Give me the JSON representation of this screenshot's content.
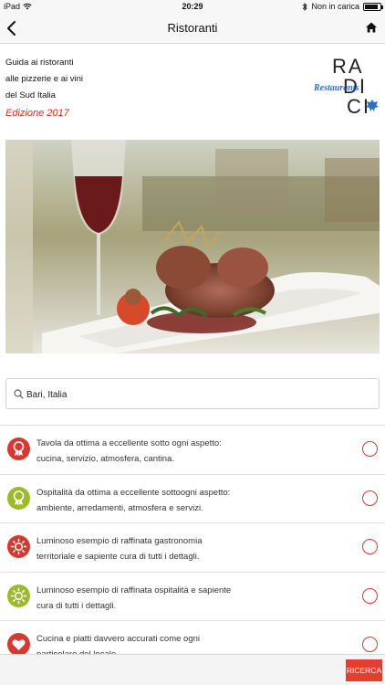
{
  "status_bar": {
    "device": "iPad",
    "time": "20:29",
    "charging": "Non in carica",
    "battery_level": 0.85
  },
  "nav": {
    "title": "Ristoranti",
    "back_icon": "chevron-left-icon",
    "home_icon": "home-icon"
  },
  "intro": {
    "line1": "Guida ai ristoranti",
    "line2": "alle pizzerie e ai vini",
    "line3": "del Sud Italia",
    "edition": "Edizione 2017"
  },
  "logo": {
    "row1": "RA",
    "row2": "DI",
    "row3": "CI",
    "script": "Restaurants"
  },
  "search": {
    "value": "Bari, Italia",
    "placeholder": ""
  },
  "categories": [
    {
      "line1": "Tavola da ottima a eccellente sotto ogni aspetto:",
      "line2": "cucina, servizio, atmosfera, cantina.",
      "icon": "award-ribbon-icon",
      "color": "#d43a31"
    },
    {
      "line1": "Ospitalità da ottima a eccellente sottoogni aspetto:",
      "line2": "ambiente, arredamenti, atmosfera e servizi.",
      "icon": "award-ribbon-icon",
      "color": "#9bbb2b"
    },
    {
      "line1": "Luminoso esempio di raffinata gastronomia",
      "line2": "territoriale e sapiente cura di tutti i dettagli.",
      "icon": "sun-icon",
      "color": "#d43a31"
    },
    {
      "line1": "Luminoso esempio di raffinata ospitalità e sapiente",
      "line2": "cura di tutti i dettagli.",
      "icon": "sun-icon",
      "color": "#9bbb2b"
    },
    {
      "line1": "Cucina e piatti davvero accurati come ogni",
      "line2": "particolare del locale.",
      "icon": "heart-icon",
      "color": "#d43a31"
    }
  ],
  "bottom": {
    "search_button": "RICERCA"
  },
  "colors": {
    "accent_red": "#d43a31",
    "accent_green": "#9bbb2b",
    "logo_blue": "#2d6fbf",
    "button_red": "#e23f2f"
  }
}
